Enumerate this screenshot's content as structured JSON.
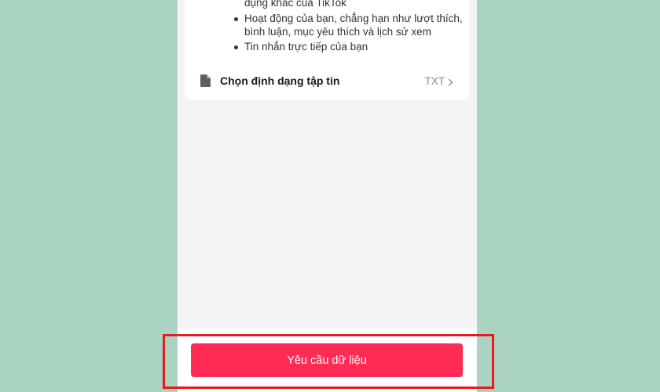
{
  "data_list": {
    "continuation": "dụng khác của TikTok",
    "items": [
      "Hoạt động của bạn, chẳng hạn như lượt thích, bình luận, mục yêu thích và lịch sử xem",
      "Tin nhắn trực tiếp của bạn"
    ]
  },
  "file_format": {
    "icon": "file-icon",
    "label": "Chọn định dạng tập tin",
    "value": "TXT",
    "chevron_icon": "chevron-right-icon"
  },
  "request_button": {
    "label": "Yêu cầu dữ liệu"
  },
  "colors": {
    "background": "#abd3c1",
    "accent": "#fe2c55",
    "highlight": "#e81a22"
  }
}
